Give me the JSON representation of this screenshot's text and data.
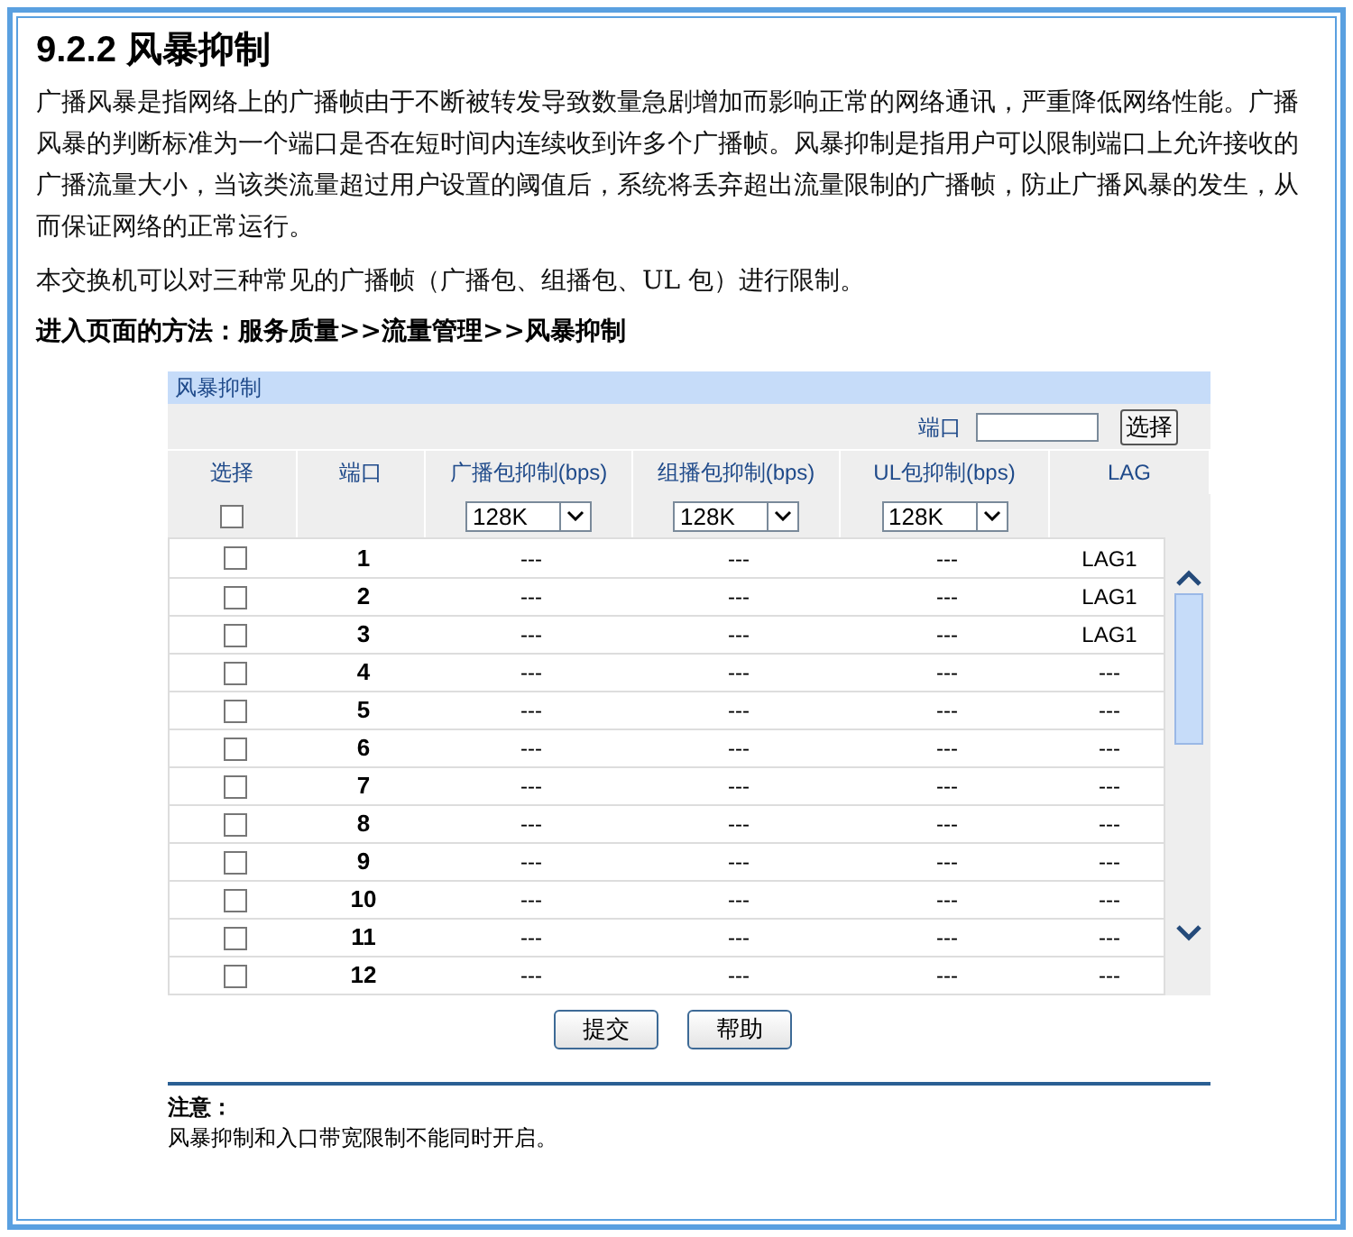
{
  "heading": "9.2.2 风暴抑制",
  "paragraphs": [
    "广播风暴是指网络上的广播帧由于不断被转发导致数量急剧增加而影响正常的网络通讯，严重降低网络性能。广播风暴的判断标准为一个端口是否在短时间内连续收到许多个广播帧。风暴抑制是指用户可以限制端口上允许接收的广播流量大小，当该类流量超过用户设置的阈值后，系统将丢弃超出流量限制的广播帧，防止广播风暴的发生，从而保证网络的正常运行。",
    "本交换机可以对三种常见的广播帧（广播包、组播包、UL 包）进行限制。"
  ],
  "navigation": "进入页面的方法：服务质量>>流量管理>>风暴抑制",
  "panel": {
    "title": "风暴抑制",
    "port_filter": {
      "label": "端口",
      "button": "选择"
    },
    "columns": [
      "选择",
      "端口",
      "广播包抑制(bps)",
      "组播包抑制(bps)",
      "UL包抑制(bps)",
      "LAG"
    ],
    "bulk_row": {
      "checked": false,
      "selects": [
        "128K",
        "128K",
        "128K"
      ]
    },
    "rows": [
      {
        "checked": false,
        "port": "1",
        "broadcast": "---",
        "multicast": "---",
        "ul": "---",
        "lag": "LAG1"
      },
      {
        "checked": false,
        "port": "2",
        "broadcast": "---",
        "multicast": "---",
        "ul": "---",
        "lag": "LAG1"
      },
      {
        "checked": false,
        "port": "3",
        "broadcast": "---",
        "multicast": "---",
        "ul": "---",
        "lag": "LAG1"
      },
      {
        "checked": false,
        "port": "4",
        "broadcast": "---",
        "multicast": "---",
        "ul": "---",
        "lag": "---"
      },
      {
        "checked": false,
        "port": "5",
        "broadcast": "---",
        "multicast": "---",
        "ul": "---",
        "lag": "---"
      },
      {
        "checked": false,
        "port": "6",
        "broadcast": "---",
        "multicast": "---",
        "ul": "---",
        "lag": "---"
      },
      {
        "checked": false,
        "port": "7",
        "broadcast": "---",
        "multicast": "---",
        "ul": "---",
        "lag": "---"
      },
      {
        "checked": false,
        "port": "8",
        "broadcast": "---",
        "multicast": "---",
        "ul": "---",
        "lag": "---"
      },
      {
        "checked": false,
        "port": "9",
        "broadcast": "---",
        "multicast": "---",
        "ul": "---",
        "lag": "---"
      },
      {
        "checked": false,
        "port": "10",
        "broadcast": "---",
        "multicast": "---",
        "ul": "---",
        "lag": "---"
      },
      {
        "checked": false,
        "port": "11",
        "broadcast": "---",
        "multicast": "---",
        "ul": "---",
        "lag": "---"
      },
      {
        "checked": false,
        "port": "12",
        "broadcast": "---",
        "multicast": "---",
        "ul": "---",
        "lag": "---"
      }
    ],
    "buttons": [
      "提交",
      "帮助"
    ],
    "note": {
      "title": "注意：",
      "text": "风暴抑制和入口带宽限制不能同时开启。"
    }
  }
}
